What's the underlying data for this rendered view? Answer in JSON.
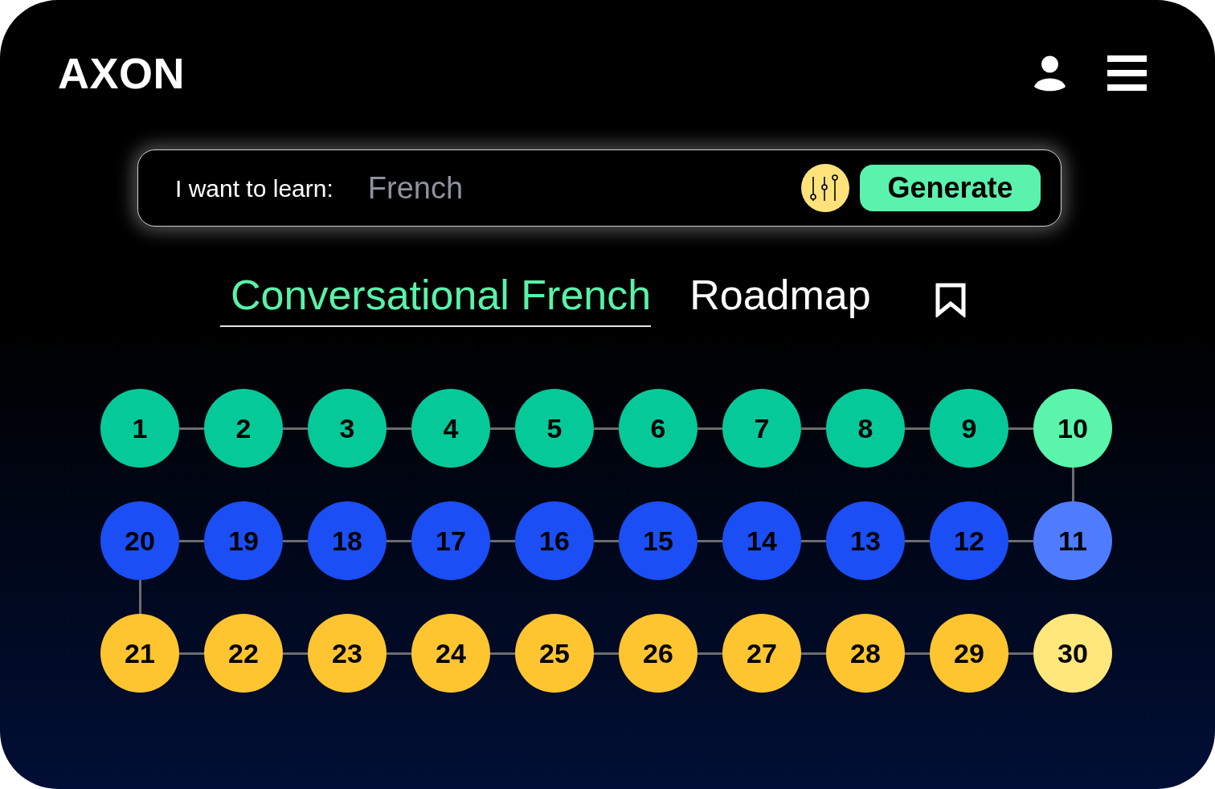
{
  "header": {
    "logo": "AXON"
  },
  "search": {
    "label": "I want to learn:",
    "value": "French",
    "button": "Generate"
  },
  "title": {
    "topic": "Conversational French",
    "suffix": "Roadmap"
  },
  "roadmap": {
    "rows": [
      {
        "nodes": [
          {
            "label": "1",
            "color": "#06c999"
          },
          {
            "label": "2",
            "color": "#06c999"
          },
          {
            "label": "3",
            "color": "#06c999"
          },
          {
            "label": "4",
            "color": "#06c999"
          },
          {
            "label": "5",
            "color": "#06c999"
          },
          {
            "label": "6",
            "color": "#06c999"
          },
          {
            "label": "7",
            "color": "#06c999"
          },
          {
            "label": "8",
            "color": "#06c999"
          },
          {
            "label": "9",
            "color": "#06c999"
          },
          {
            "label": "10",
            "color": "#5af4ab"
          }
        ]
      },
      {
        "nodes": [
          {
            "label": "20",
            "color": "#1b4ef4"
          },
          {
            "label": "19",
            "color": "#1b4ef4"
          },
          {
            "label": "18",
            "color": "#1b4ef4"
          },
          {
            "label": "17",
            "color": "#1b4ef4"
          },
          {
            "label": "16",
            "color": "#1b4ef4"
          },
          {
            "label": "15",
            "color": "#1b4ef4"
          },
          {
            "label": "14",
            "color": "#1b4ef4"
          },
          {
            "label": "13",
            "color": "#1b4ef4"
          },
          {
            "label": "12",
            "color": "#1b4ef4"
          },
          {
            "label": "11",
            "color": "#4f7cff"
          }
        ]
      },
      {
        "nodes": [
          {
            "label": "21",
            "color": "#ffc531"
          },
          {
            "label": "22",
            "color": "#ffc531"
          },
          {
            "label": "23",
            "color": "#ffc531"
          },
          {
            "label": "24",
            "color": "#ffc531"
          },
          {
            "label": "25",
            "color": "#ffc531"
          },
          {
            "label": "26",
            "color": "#ffc531"
          },
          {
            "label": "27",
            "color": "#ffc531"
          },
          {
            "label": "28",
            "color": "#ffc531"
          },
          {
            "label": "29",
            "color": "#ffc531"
          },
          {
            "label": "30",
            "color": "#ffe77c"
          }
        ]
      }
    ]
  }
}
